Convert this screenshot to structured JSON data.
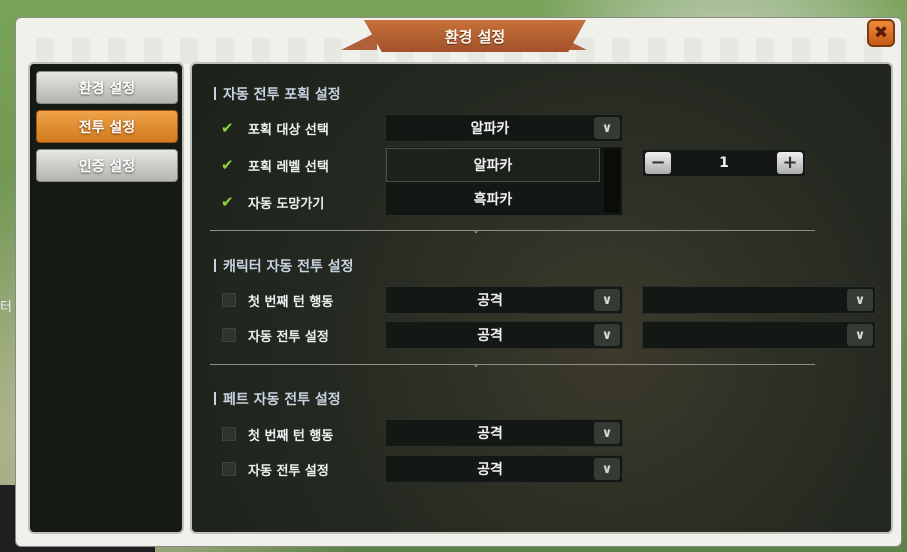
{
  "window": {
    "title": "환경 설정",
    "close_icon": "close-x-icon"
  },
  "world_text": "터",
  "sidebar": {
    "items": [
      {
        "label": "환경 설정",
        "active": false
      },
      {
        "label": "전투 설정",
        "active": true
      },
      {
        "label": "인증 설정",
        "active": false
      }
    ]
  },
  "capture_section": {
    "title": "자동 전투 포획 설정",
    "target_label": "포획 대상 선택",
    "target_value": "알파카",
    "level_label": "포획 레벨 선택",
    "auto_flee_label": "자동 도망가기",
    "dropdown_options": [
      "알파카",
      "흑파카"
    ],
    "level_value": "1",
    "minus_label": "−",
    "plus_label": "+"
  },
  "character_section": {
    "title": "캐릭터 자동 전투 설정",
    "first_turn_label": "첫 번째 턴 행동",
    "first_turn_value": "공격",
    "auto_battle_label": "자동 전투 설정",
    "auto_battle_value": "공격"
  },
  "pet_section": {
    "title": "페트 자동 전투 설정",
    "first_turn_label": "첫 번째 턴 행동",
    "first_turn_value": "공격",
    "auto_battle_label": "자동 전투 설정",
    "auto_battle_value": "공격"
  },
  "checkmark_glyph": "✔",
  "arrow_glyph": "∨",
  "colors": {
    "accent": "#d07a1e",
    "check": "#8fd13f",
    "section_title": "#c7d3e2"
  }
}
